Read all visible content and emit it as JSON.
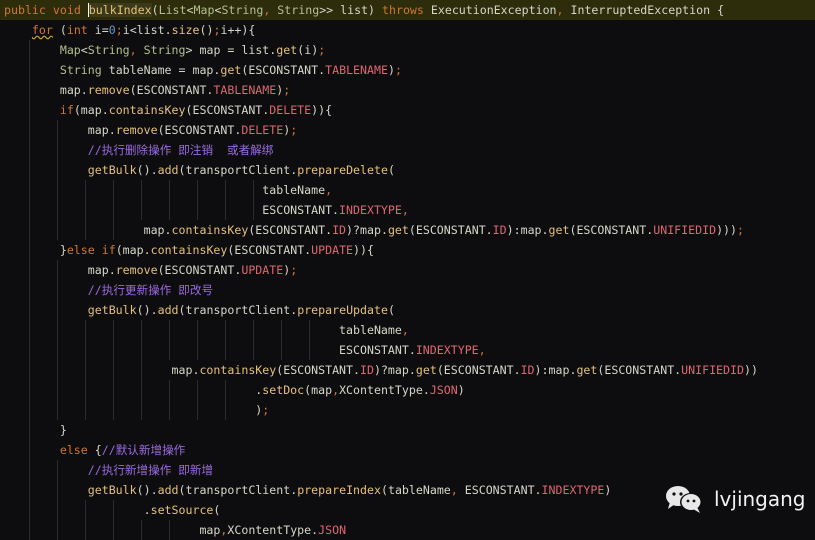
{
  "editor": {
    "highlighted_line": 0,
    "lines": [
      "public void bulkIndex(List<Map<String, String>> list) throws ExecutionException, InterruptedException {",
      "    for (int i=0;i<list.size();i++){",
      "        Map<String, String> map = list.get(i);",
      "        String tableName = map.get(ESCONSTANT.TABLENAME);",
      "        map.remove(ESCONSTANT.TABLENAME);",
      "        if(map.containsKey(ESCONSTANT.DELETE)){",
      "            map.remove(ESCONSTANT.DELETE);",
      "            //执行删除操作 即注销  或者解绑",
      "            getBulk().add(transportClient.prepareDelete(",
      "                                     tableName,",
      "                                     ESCONSTANT.INDEXTYPE,",
      "                    map.containsKey(ESCONSTANT.ID)?map.get(ESCONSTANT.ID):map.get(ESCONSTANT.UNIFIEDID)));",
      "        }else if(map.containsKey(ESCONSTANT.UPDATE)){",
      "            map.remove(ESCONSTANT.UPDATE);",
      "            //执行更新操作 即改号",
      "            getBulk().add(transportClient.prepareUpdate(",
      "                                                tableName,",
      "                                                ESCONSTANT.INDEXTYPE,",
      "                        map.containsKey(ESCONSTANT.ID)?map.get(ESCONSTANT.ID):map.get(ESCONSTANT.UNIFIEDID))",
      "                                    .setDoc(map,XContentType.JSON)",
      "                                    );",
      "        }",
      "        else {//默认新增操作",
      "            //执行新增操作 即新增",
      "            getBulk().add(transportClient.prepareIndex(tableName, ESCONSTANT.INDEXTYPE)",
      "                    .setSource(",
      "                            map,XContentType.JSON"
    ]
  },
  "watermark": {
    "icon": "wechat-icon",
    "text": "lvjingang"
  }
}
